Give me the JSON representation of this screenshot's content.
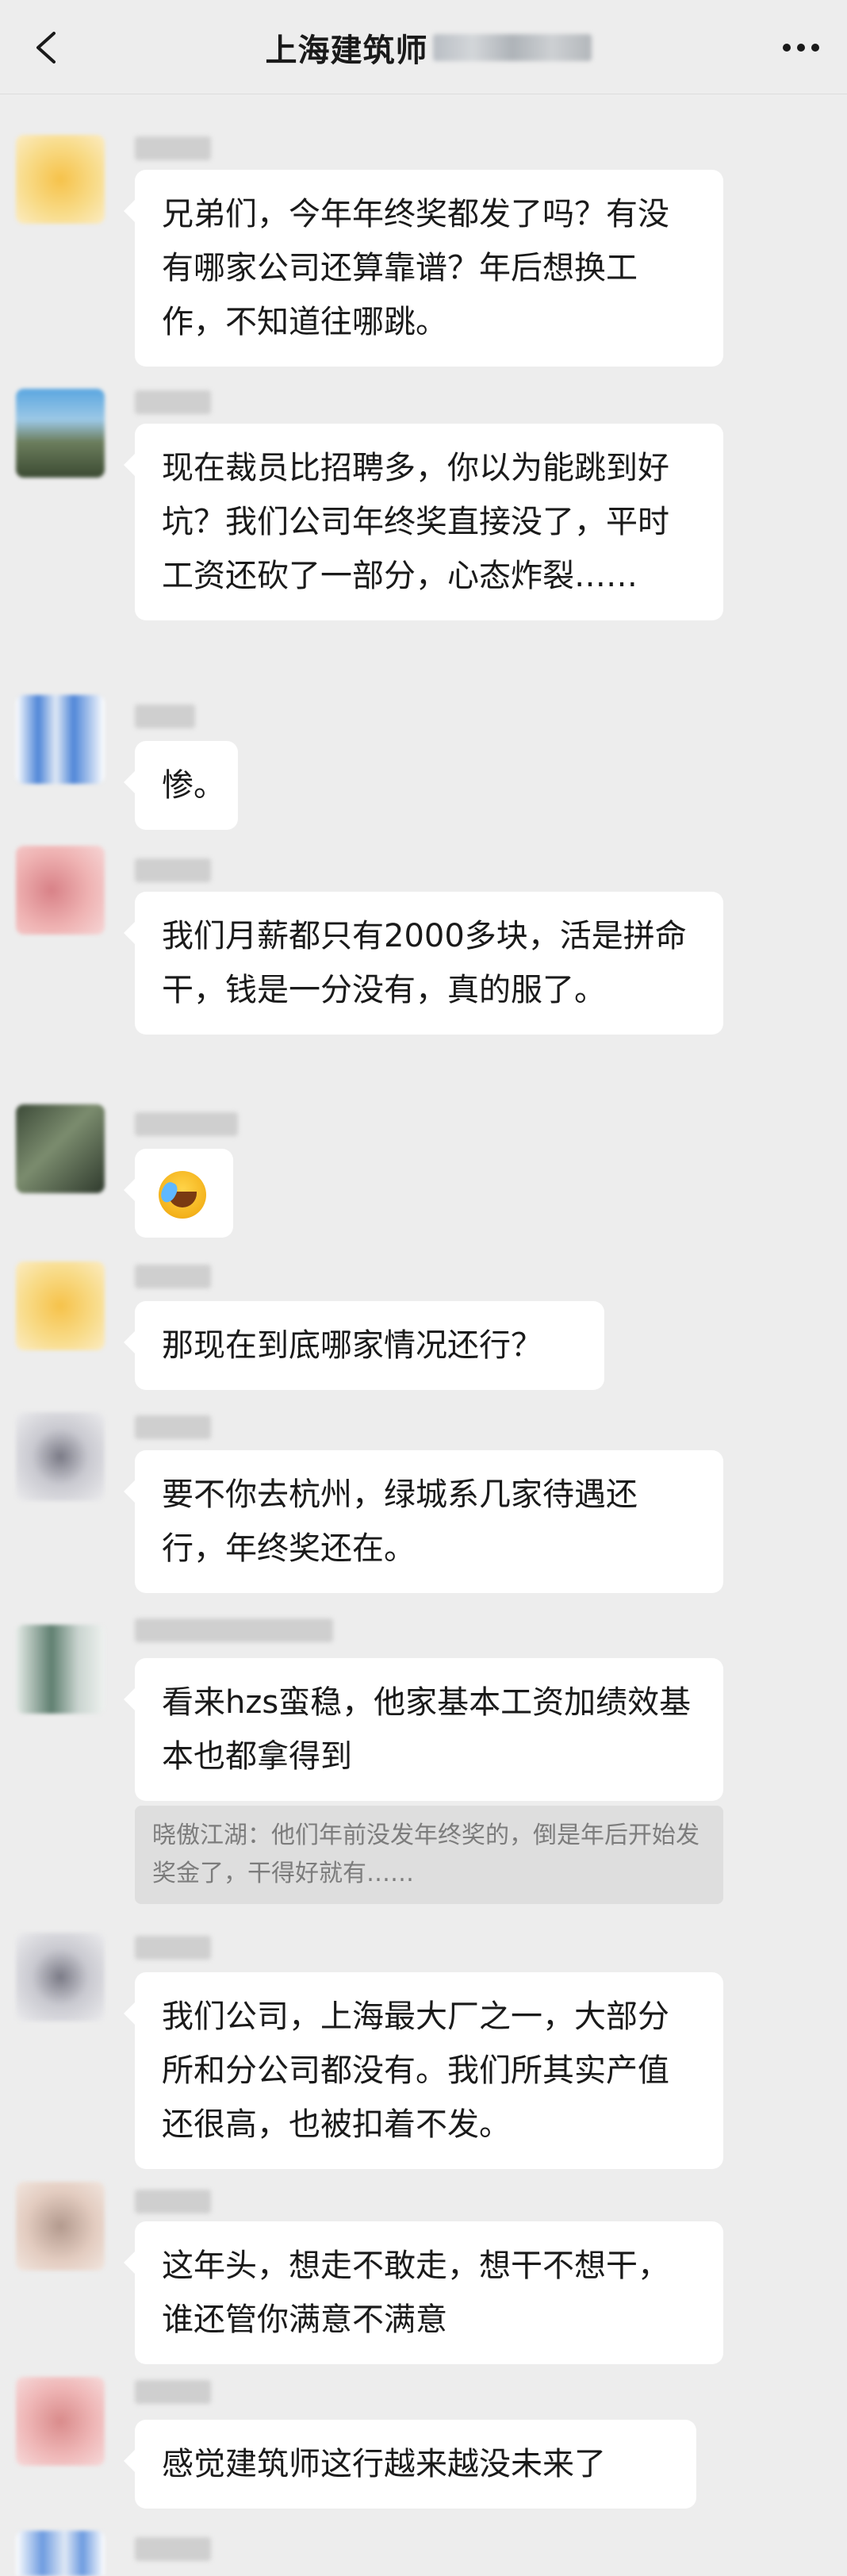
{
  "header": {
    "title": "上海建筑师"
  },
  "messages": [
    {
      "text": "兄弟们，今年年终奖都发了吗？有没有哪家公司还算靠谱？年后想换工作，不知道往哪跳。",
      "avatar_color": "#f6cf66"
    },
    {
      "text": "现在裁员比招聘多，你以为能跳到好坑？我们公司年终奖直接没了，平时工资还砍了一部分，心态炸裂……",
      "avatar_color": "#6c9ab4"
    },
    {
      "text": "惨。",
      "avatar_color": "#4f86d8"
    },
    {
      "text": "我们月薪都只有2000多块，活是拼命干，钱是一分没有，真的服了。",
      "avatar_color": "#e9a1a4"
    },
    {
      "text": "",
      "emoji": "laughing-crying-emoji",
      "avatar_color": "#4c5a48"
    },
    {
      "text": "那现在到底哪家情况还行？",
      "avatar_color": "#f6cf66"
    },
    {
      "text": "要不你去杭州，绿城系几家待遇还行，年终奖还在。",
      "avatar_color": "#b4b4bc"
    },
    {
      "text": "看来hzs蛮稳，他家基本工资加绩效基本也都拿得到",
      "quote": "晓傲江湖：他们年前没发年终奖的，倒是年后开始发奖金了，干得好就有……",
      "avatar_color": "#7f9b8e"
    },
    {
      "text": "我们公司，上海最大厂之一，大部分所和分公司都没有。我们所其实产值还很高，也被扣着不发。",
      "avatar_color": "#b4b4bc"
    },
    {
      "text": "这年头，想走不敢走，想干不想干，谁还管你满意不满意",
      "avatar_color": "#d9b7a6"
    },
    {
      "text": "感觉建筑师这行越来越没未来了",
      "avatar_color": "#eaa6a6"
    },
    {
      "text": "",
      "avatar_color": "#6d9be0"
    }
  ]
}
